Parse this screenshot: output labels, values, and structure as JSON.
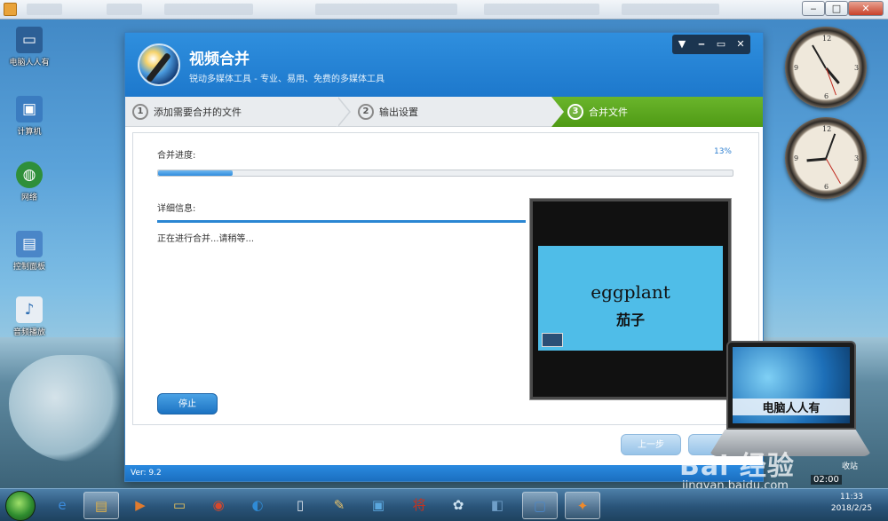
{
  "player": {
    "window_buttons": {
      "minimize": "‒",
      "maximize": "□",
      "close": "✕"
    }
  },
  "desktop": {
    "icons": [
      {
        "label": "电脑人人有",
        "icon": "laptop-icon",
        "color": "#2c5f96"
      },
      {
        "label": "计算机",
        "icon": "computer-icon",
        "color": "#3b7cc0"
      },
      {
        "label": "网络",
        "icon": "network-icon",
        "color": "#2f8f3a"
      },
      {
        "label": "控制面板",
        "icon": "control-panel-icon",
        "color": "#4a86c8"
      },
      {
        "label": "音频播放",
        "icon": "audio-file-icon",
        "color": "#e8eef4"
      }
    ],
    "clocks": [
      "clock-gadget-1",
      "clock-gadget-2"
    ]
  },
  "app": {
    "title": "视频合并",
    "subtitle": "锐动多媒体工具 - 专业、易用、免费的多媒体工具",
    "title_buttons": [
      "▼",
      "‒",
      "▭",
      "✕"
    ],
    "steps": [
      {
        "num": "1",
        "label": "添加需要合并的文件"
      },
      {
        "num": "2",
        "label": "输出设置"
      },
      {
        "num": "3",
        "label": "合并文件"
      }
    ],
    "progress": {
      "label": "合并进度:",
      "percent_text": "13%",
      "fraction": 0.13
    },
    "details": {
      "label": "详细信息:",
      "message": "正在进行合并...请稍等..."
    },
    "stop_label": "停止",
    "preview": {
      "english": "eggplant",
      "chinese": "茄子"
    },
    "prev_label": "上一步",
    "version": "Ver: 9.2"
  },
  "overlay": {
    "laptop_brand": "电脑人人有",
    "watermark": "Bai 经验",
    "watermark_url": "jingyan.baidu.com",
    "collapse_label": "收站",
    "timer": "02:00"
  },
  "taskbar": {
    "time": "11:33",
    "date": "2018/2/25",
    "apps": [
      {
        "icon": "ie-icon",
        "glyph": "e",
        "color": "#3b8ad9"
      },
      {
        "icon": "explorer-icon",
        "glyph": "▤",
        "color": "#e2b24a"
      },
      {
        "icon": "media-player-icon",
        "glyph": "▶",
        "color": "#e07b2e"
      },
      {
        "icon": "folder-icon",
        "glyph": "▭",
        "color": "#e8c25a"
      },
      {
        "icon": "chrome-icon",
        "glyph": "◉",
        "color": "#d9482b"
      },
      {
        "icon": "browser-icon",
        "glyph": "◐",
        "color": "#2f8bd6"
      },
      {
        "icon": "document-icon",
        "glyph": "▯",
        "color": "#dfe6ee"
      },
      {
        "icon": "paint-icon",
        "glyph": "✎",
        "color": "#e9c36a"
      },
      {
        "icon": "monitor-icon",
        "glyph": "▣",
        "color": "#5aa7de"
      },
      {
        "icon": "chess-icon",
        "glyph": "将",
        "color": "#c8321d"
      },
      {
        "icon": "flower-icon",
        "glyph": "✿",
        "color": "#cfe4f2"
      },
      {
        "icon": "window-icon",
        "glyph": "◧",
        "color": "#6f9fc8"
      },
      {
        "icon": "display-icon",
        "glyph": "▢",
        "color": "#4a86c8"
      },
      {
        "icon": "video-merge-icon",
        "glyph": "✦",
        "color": "#f08a2a"
      }
    ]
  }
}
